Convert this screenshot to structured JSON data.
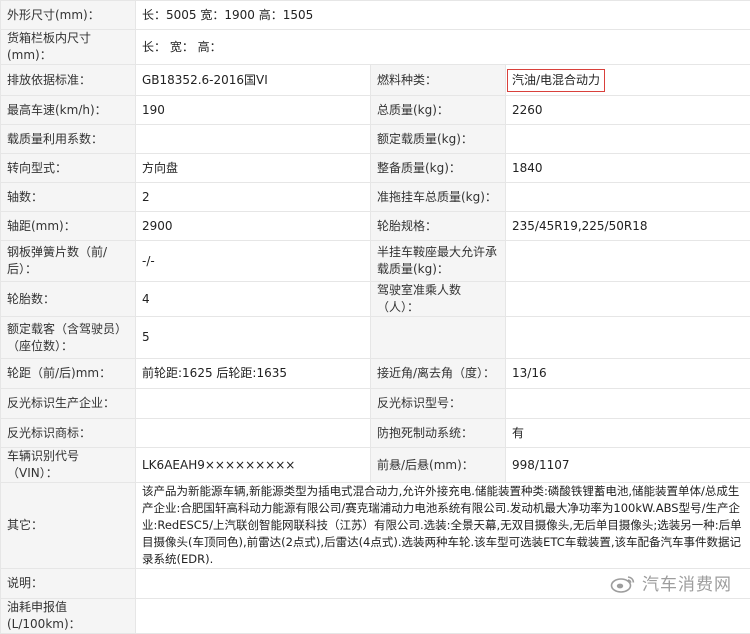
{
  "rows": [
    {
      "l1": "外形尺寸(mm)：",
      "v1": "长：5005 宽：1900 高：1505",
      "span": true
    },
    {
      "l1": "货箱栏板内尺寸(mm)：",
      "v1": "长： 宽： 高：",
      "span": true
    },
    {
      "l1": "排放依据标准：",
      "v1": "GB18352.6-2016国VI",
      "l2": "燃料种类：",
      "v2": "汽油/电混合动力"
    },
    {
      "l1": "最高车速(km/h)：",
      "v1": "190",
      "l2": "总质量(kg)：",
      "v2": "2260"
    },
    {
      "l1": "载质量利用系数：",
      "v1": "",
      "l2": "额定载质量(kg)：",
      "v2": ""
    },
    {
      "l1": "转向型式：",
      "v1": "方向盘",
      "l2": "整备质量(kg)：",
      "v2": "1840"
    },
    {
      "l1": "轴数：",
      "v1": "2",
      "l2": "准拖挂车总质量(kg)：",
      "v2": ""
    },
    {
      "l1": "轴距(mm)：",
      "v1": "2900",
      "l2": "轮胎规格：",
      "v2": "235/45R19,225/50R18"
    },
    {
      "l1": "钢板弹簧片数（前/后）：",
      "v1": "-/-",
      "l2": "半挂车鞍座最大允许承载质量(kg)：",
      "v2": ""
    },
    {
      "l1": "轮胎数：",
      "v1": "4",
      "l2": "驾驶室准乘人数（人）：",
      "v2": ""
    },
    {
      "l1": "额定载客（含驾驶员）（座位数）：",
      "v1": "5",
      "l2": "",
      "v2": ""
    },
    {
      "l1": "轮距（前/后)mm：",
      "v1": "前轮距:1625 后轮距:1635",
      "l2": "接近角/离去角（度）：",
      "v2": "13/16"
    },
    {
      "l1": "反光标识生产企业：",
      "v1": "",
      "l2": "反光标识型号：",
      "v2": ""
    },
    {
      "l1": "反光标识商标：",
      "v1": "",
      "l2": "防抱死制动系统：",
      "v2": "有"
    },
    {
      "l1": "车辆识别代号（VIN）：",
      "v1": "LK6AEAH9×××××××××",
      "l2": "前悬/后悬(mm)：",
      "v2": "998/1107"
    },
    {
      "l1": "其它：",
      "v1": "该产品为新能源车辆,新能源类型为插电式混合动力,允许外接充电.储能装置种类:磷酸铁锂蓄电池,储能装置单体/总成生产企业:合肥国轩高科动力能源有限公司/赛克瑞浦动力电池系统有限公司.发动机最大净功率为100kW.ABS型号/生产企业:RedESC5/上汽联创智能网联科技（江苏）有限公司.选装:全景天幕,无双目摄像头,无后单目摄像头;选装另一种:后单目摄像头(车顶同色),前雷达(2点式),后雷达(4点式).选装两种车轮.该车型可选装ETC车载装置,该车配备汽车事件数据记录系统(EDR).",
      "span": true
    },
    {
      "l1": "说明：",
      "v1": "",
      "span": true
    },
    {
      "l1": "油耗申报值(L/100km)：",
      "v1": "",
      "span": true
    }
  ],
  "watermark": {
    "text": "汽车消费网",
    "icon": "weibo-icon"
  },
  "colors": {
    "label_bg": "#f5f5f5",
    "border": "#e6e6e6",
    "highlight": "#d9403b"
  }
}
